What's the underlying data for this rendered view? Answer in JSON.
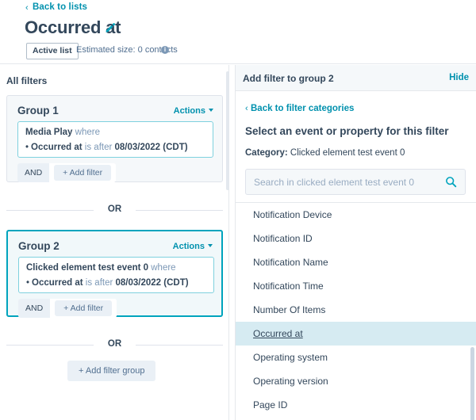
{
  "header": {
    "back_chevron": "‹",
    "back_link": "Back to lists",
    "title": "Occurred at",
    "edit_icon": "pencil-icon",
    "list_type_badge": "Active list",
    "estimated_size": "Estimated size: 0 contacts",
    "info_icon": "i"
  },
  "left_panel": {
    "section_label": "All filters",
    "groups": [
      {
        "title": "Group 1",
        "actions_label": "Actions",
        "filter": {
          "event": "Media Play",
          "where": "where",
          "bullet": "•",
          "property": "Occurred at",
          "operator": "is after",
          "value": "08/03/2022 (CDT)"
        },
        "and_label": "AND",
        "add_filter_label": "+ Add filter",
        "selected": false
      },
      {
        "title": "Group 2",
        "actions_label": "Actions",
        "filter": {
          "event": "Clicked element test event 0",
          "where": "where",
          "bullet": "•",
          "property": "Occurred at",
          "operator": "is after",
          "value": "08/03/2022 (CDT)"
        },
        "and_label": "AND",
        "add_filter_label": "+ Add filter",
        "selected": true
      }
    ],
    "or_label": "OR",
    "add_filter_group_label": "+ Add filter group"
  },
  "right_panel": {
    "header_title": "Add filter to group 2",
    "hide_label": "Hide",
    "back_chevron": "‹",
    "back_label": "Back to filter categories",
    "heading": "Select an event or property for this filter",
    "category_label": "Category:",
    "category_value": "Clicked element test event 0",
    "search_placeholder": "Search in clicked element test event 0",
    "search_value": "",
    "search_icon": "search-icon",
    "properties": [
      {
        "label": "Notification Device",
        "selected": false
      },
      {
        "label": "Notification ID",
        "selected": false
      },
      {
        "label": "Notification Name",
        "selected": false
      },
      {
        "label": "Notification Time",
        "selected": false
      },
      {
        "label": "Number Of Items",
        "selected": false
      },
      {
        "label": "Occurred at",
        "selected": true
      },
      {
        "label": "Operating system",
        "selected": false
      },
      {
        "label": "Operating version",
        "selected": false
      },
      {
        "label": "Page ID",
        "selected": false
      }
    ]
  },
  "colors": {
    "accent_teal": "#00a4bd",
    "link_teal": "#0091ae",
    "text_dark": "#33475b",
    "text_muted": "#7c98b6",
    "selected_row_bg": "#d6ebf2",
    "panel_bg": "#f5f8fa",
    "chip_bg": "#eaf0f6"
  }
}
